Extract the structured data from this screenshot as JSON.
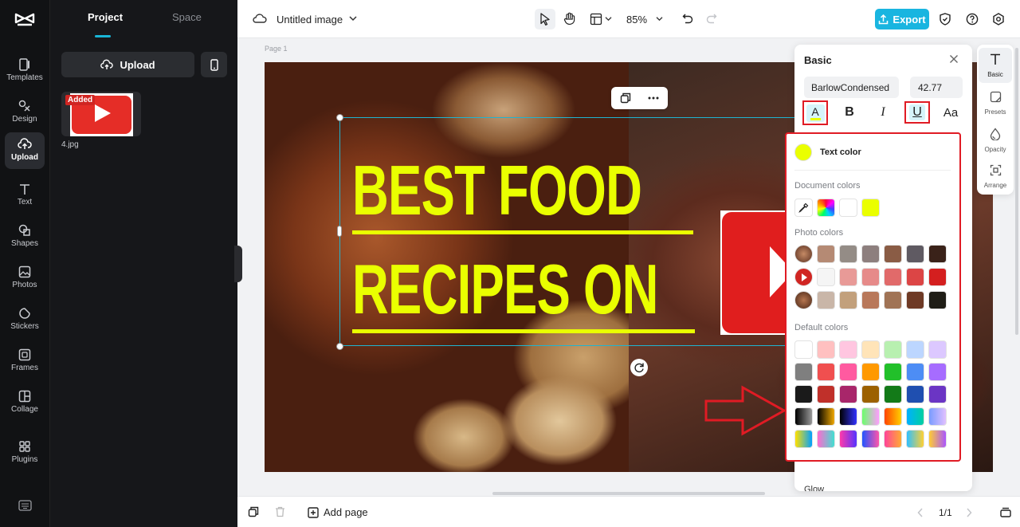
{
  "sidebar": {
    "items": [
      {
        "label": "Templates",
        "icon": "templates-icon"
      },
      {
        "label": "Design",
        "icon": "design-icon"
      },
      {
        "label": "Upload",
        "icon": "upload-icon",
        "active": true
      },
      {
        "label": "Text",
        "icon": "text-icon"
      },
      {
        "label": "Shapes",
        "icon": "shapes-icon"
      },
      {
        "label": "Photos",
        "icon": "photos-icon"
      },
      {
        "label": "Stickers",
        "icon": "stickers-icon"
      },
      {
        "label": "Frames",
        "icon": "frames-icon"
      },
      {
        "label": "Collage",
        "icon": "collage-icon"
      },
      {
        "label": "Plugins",
        "icon": "plugins-icon"
      }
    ]
  },
  "panel": {
    "tabs": [
      "Project",
      "Space"
    ],
    "active_tab": "Project",
    "upload_label": "Upload",
    "file": {
      "name": "4.jpg",
      "badge": "Added"
    }
  },
  "topbar": {
    "title": "Untitled image",
    "zoom": "85%",
    "export_label": "Export"
  },
  "canvas": {
    "page_label": "Page 1",
    "headline_1": "BEST FOOD",
    "headline_2": "RECIPES ON"
  },
  "basic_panel": {
    "title": "Basic",
    "font": "BarlowCondensed",
    "size": "42.77",
    "bold": "B",
    "italic": "I",
    "underline": "U",
    "case": "Aa",
    "color_btn": "A",
    "glow_label": "Glow"
  },
  "color_popover": {
    "title": "Text color",
    "current": "#eaff00",
    "document_label": "Document colors",
    "photo_label": "Photo colors",
    "default_label": "Default colors",
    "document_colors": [
      "#ffffff",
      "#eaff00"
    ],
    "photo_colors": [
      [
        "#b58a74",
        "#948c86",
        "#8d7f7e",
        "#8a5c45",
        "#5f5a62",
        "#3a2219"
      ],
      [
        "#f5f5f5",
        "#e89a97",
        "#e68a89",
        "#e16a6a",
        "#dc4545",
        "#d41f1f"
      ],
      [
        "#c9b6a8",
        "#c2a07c",
        "#b8785a",
        "#a07355",
        "#6e3a25",
        "#1f1d16"
      ]
    ],
    "default_colors": [
      [
        "#ffffff",
        "#ffc0c0",
        "#ffc6e0",
        "#ffe4b8",
        "#b8f0b0",
        "#bcd6ff",
        "#dcc8ff"
      ],
      [
        "#7f7f7f",
        "#f04f4f",
        "#ff5aa0",
        "#ff9900",
        "#22c02a",
        "#4d8df5",
        "#a66cff"
      ],
      [
        "#1a1a1a",
        "#c0302a",
        "#a8266a",
        "#9c6100",
        "#137a18",
        "#1f4fb0",
        "#6b35c4"
      ],
      [
        "grad:#000,#999",
        "grad:#000,#f0a800",
        "grad:#000,#3333ff",
        "grad:#6bff6b,#ff9cff",
        "grad:#ff4400,#ffd000",
        "grad:#00b0ff,#00d0a0",
        "grad:#7a9cff,#e0c0ff"
      ],
      [
        "grad:#ffe000,#00a0ff",
        "grad:#ff6bd0,#40e0d0",
        "grad:#ff3aaa,#5533ff",
        "grad:#2255ff,#ff55aa",
        "grad:#ff4499,#ffaa33",
        "grad:#30c0ff,#ffd033",
        "grad:#ffcc33,#aa55ff"
      ]
    ]
  },
  "tool_strip": {
    "items": [
      {
        "label": "Basic",
        "icon": "text-style-icon",
        "active": true
      },
      {
        "label": "Presets",
        "icon": "presets-icon"
      },
      {
        "label": "Opacity",
        "icon": "opacity-icon"
      },
      {
        "label": "Arrange",
        "icon": "arrange-icon"
      }
    ]
  },
  "bottombar": {
    "add_page": "Add page",
    "page_count": "1/1"
  },
  "colors": {
    "accent": "#19b5e0",
    "annotation": "#e01b24",
    "text_yellow": "#eaff00"
  }
}
